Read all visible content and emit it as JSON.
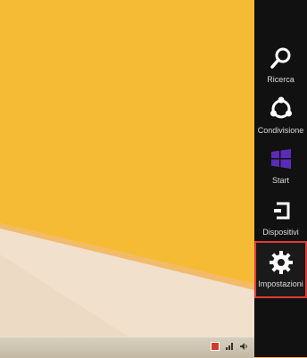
{
  "charms": [
    {
      "key": "search",
      "label": "Ricerca",
      "icon": "search-icon"
    },
    {
      "key": "share",
      "label": "Condivisione",
      "icon": "share-icon"
    },
    {
      "key": "start",
      "label": "Start",
      "icon": "windows-logo-icon"
    },
    {
      "key": "devices",
      "label": "Dispositivi",
      "icon": "devices-icon"
    },
    {
      "key": "settings",
      "label": "Impostazioni",
      "icon": "gear-icon",
      "selected": true
    }
  ],
  "colors": {
    "desktop_yellow": "#f6bb34",
    "desktop_cream": "#f7eadb",
    "charm_bar": "#111111",
    "start_purple": "#5b2bb5",
    "selection_red": "#e13a36"
  },
  "taskbar": {
    "tray_icons": [
      "notification-flag-icon",
      "network-icon",
      "volume-icon"
    ]
  }
}
